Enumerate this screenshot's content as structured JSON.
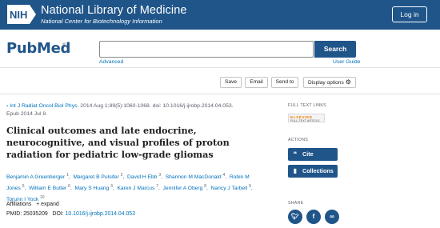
{
  "nlm": {
    "badge": "NIH",
    "title": "National Library of Medicine",
    "subtitle": "National Center for Biotechnology Information",
    "login_label": "Log in"
  },
  "search": {
    "logo_pub": "Pub",
    "logo_med": "Med",
    "logo_reg": "®",
    "value": "",
    "button_label": "Search",
    "advanced_label": "Advanced",
    "user_guide_label": "User Guide"
  },
  "actions": {
    "save": "Save",
    "email": "Email",
    "send_to": "Send to",
    "display_options": "Display options"
  },
  "article": {
    "journal": "Int J Radiat Oncol Biol Phys.",
    "citation_rest": "2014 Aug 1;89(5):1060-1068. doi: 10.1016/j.ijrobp.2014.04.053.",
    "epub": "Epub 2014 Jul 8.",
    "title": "Clinical outcomes and late endocrine, neurocognitive, and visual profiles of proton radiation for pediatric low-grade gliomas",
    "authors": [
      {
        "name": "Benjamin A Greenberger",
        "sup": "1"
      },
      {
        "name": "Margaret B Pulsifer",
        "sup": "2"
      },
      {
        "name": "David H Ebb",
        "sup": "3"
      },
      {
        "name": "Shannon M MacDonald",
        "sup": "4"
      },
      {
        "name": "Robin M Jones",
        "sup": "5"
      },
      {
        "name": "William E Butler",
        "sup": "6"
      },
      {
        "name": "Mary S Huang",
        "sup": "3"
      },
      {
        "name": "Karen J Marcus",
        "sup": "7"
      },
      {
        "name": "Jennifer A Oberg",
        "sup": "8"
      },
      {
        "name": "Nancy J Tarbell",
        "sup": "9"
      },
      {
        "name": "Torunn I Yock",
        "sup": "10"
      }
    ],
    "affiliations_label": "Affiliations",
    "expand_label": "+ expand",
    "pmid_label": "PMID:",
    "pmid": "25035209",
    "doi_label": "DOI:",
    "doi": "10.1016/j.ijrobp.2014.04.053"
  },
  "sidebar": {
    "full_text_links_label": "FULL TEXT LINKS",
    "elsevier_top": "ELSEVIER",
    "elsevier_bottom": "FULL-TEXT ARTICLE",
    "actions_label": "ACTIONS",
    "cite_label": "Cite",
    "collections_label": "Collections",
    "share_label": "SHARE"
  },
  "colors": {
    "brand": "#20558a",
    "link": "#0071bc",
    "elsevier": "#f07d00"
  }
}
